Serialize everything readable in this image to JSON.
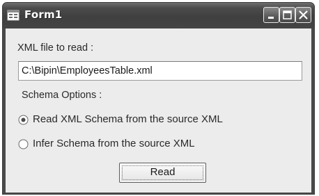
{
  "window": {
    "title": "Form1",
    "icon": "form-window-icon",
    "controls": [
      "minimize-icon",
      "maximize-icon",
      "close-icon"
    ]
  },
  "form": {
    "xml_file_label": "XML file to read :",
    "xml_file_value": "C:\\Bipin\\EmployeesTable.xml",
    "schema_options_label": "Schema Options :",
    "options": [
      {
        "label": "Read XML Schema from the source XML",
        "selected": true
      },
      {
        "label": "Infer Schema from the source XML",
        "selected": false
      }
    ],
    "read_button_label": "Read"
  }
}
